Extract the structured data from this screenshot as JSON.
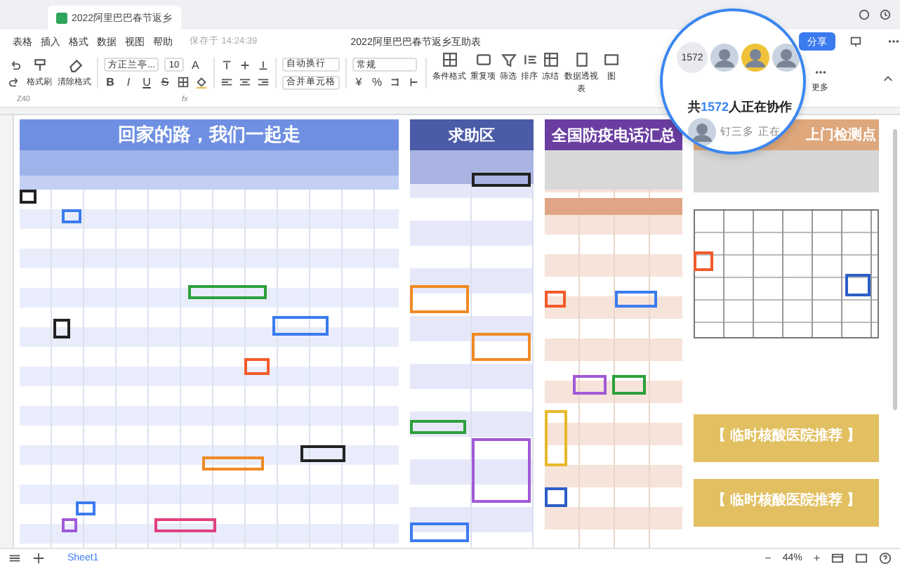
{
  "tab": {
    "title": "2022阿里巴巴春节返乡"
  },
  "menu": [
    "表格",
    "插入",
    "格式",
    "数据",
    "视图",
    "帮助"
  ],
  "save_status": "保存于 14:24:39",
  "document_title": "2022阿里巴巴春节返乡互助表",
  "share_button": "分享",
  "toolbar": {
    "format_tools": [
      "格式刷",
      "清除格式"
    ],
    "font": "方正兰亭...",
    "size": "10",
    "text_color": "A",
    "styles": [
      "B",
      "I",
      "U",
      "S"
    ],
    "wrap": "自动换行",
    "merge": "合并单元格",
    "number_format": "常规",
    "number_symbols": [
      "¥",
      "%"
    ],
    "tools": [
      "条件格式",
      "重复项",
      "筛选",
      "排序",
      "冻结",
      "数据透视表",
      "图"
    ],
    "more": "更多"
  },
  "formula_bar": {
    "cell": "Z40",
    "fx": "fx"
  },
  "panels": [
    {
      "kind": "main",
      "title": "回家的路，我们一起走",
      "color": "#6f8fe2"
    },
    {
      "kind": "help",
      "title": "求助区",
      "color": "#4b5ba7"
    },
    {
      "kind": "phone",
      "title": "全国防疫电话汇总",
      "color": "#6a3ea0"
    },
    {
      "kind": "testing",
      "title": "上门检测点",
      "color": "#dea77c",
      "cards": [
        "【 临时核酸医院推荐 】",
        "【 临时核酸医院推荐 】"
      ]
    }
  ],
  "collab_popup": {
    "count": "1572",
    "text_before": "共",
    "text_count": "1572",
    "text_after": "人正在协作",
    "user": "钉三多",
    "user_status": "正在"
  },
  "sheets": [
    {
      "label": "Sheet1",
      "selected": true
    }
  ],
  "zoom": {
    "value": "44%",
    "minus": "−",
    "plus": "+"
  }
}
